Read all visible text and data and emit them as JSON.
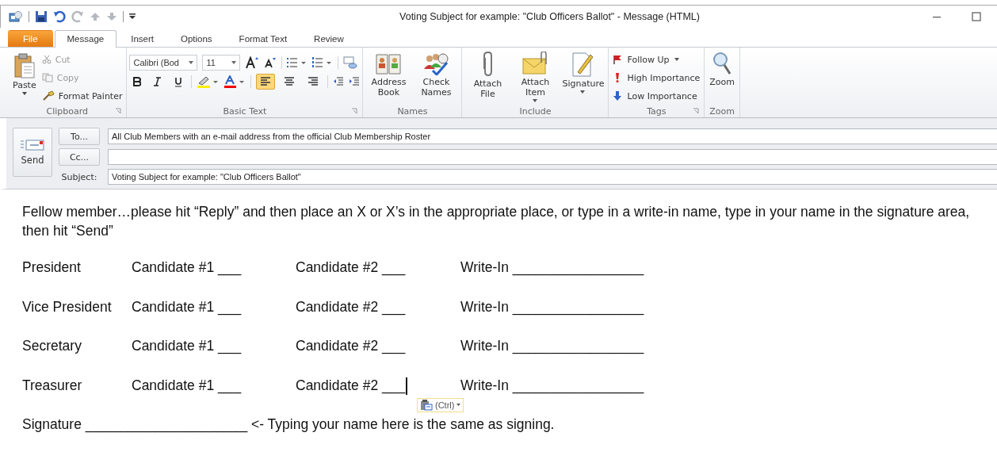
{
  "window": {
    "title": "Voting Subject for example: \"Club Officers Ballot\"  -  Message (HTML)"
  },
  "tabs": [
    {
      "label": "File",
      "kind": "file",
      "selected": false
    },
    {
      "label": "Message",
      "kind": "tab",
      "selected": true
    },
    {
      "label": "Insert",
      "kind": "tab",
      "selected": false
    },
    {
      "label": "Options",
      "kind": "tab",
      "selected": false
    },
    {
      "label": "Format Text",
      "kind": "tab",
      "selected": false
    },
    {
      "label": "Review",
      "kind": "tab",
      "selected": false
    }
  ],
  "ribbon": {
    "clipboard": {
      "label": "Clipboard",
      "paste": "Paste",
      "cut": "Cut",
      "copy": "Copy",
      "format_painter": "Format Painter"
    },
    "basic_text": {
      "label": "Basic Text",
      "font": "Calibri (Bod",
      "size": "11",
      "alignment": [
        {
          "selected": true
        },
        {
          "selected": false
        },
        {
          "selected": false
        }
      ]
    },
    "names": {
      "label": "Names",
      "buttons": [
        {
          "label": "Address Book",
          "kind": "address"
        },
        {
          "label": "Check Names",
          "kind": "check"
        }
      ]
    },
    "include": {
      "label": "Include",
      "buttons": [
        {
          "label": "Attach File",
          "kind": "clip",
          "dropdown": false
        },
        {
          "label": "Attach Item",
          "kind": "envelope",
          "dropdown": true
        },
        {
          "label": "Signature",
          "kind": "signature",
          "dropdown": true
        }
      ]
    },
    "tags": {
      "label": "Tags",
      "items": [
        {
          "label": "Follow Up",
          "kind": "flag",
          "dropdown": true
        },
        {
          "label": "High Importance",
          "kind": "high",
          "dropdown": false
        },
        {
          "label": "Low Importance",
          "kind": "low",
          "dropdown": false
        }
      ]
    },
    "zoom": {
      "label": "Zoom",
      "button": "Zoom"
    }
  },
  "header": {
    "send": "Send",
    "to": {
      "button": "To...",
      "value": "All Club Members with an e-mail address from the official Club Membership Roster"
    },
    "cc": {
      "button": "Cc..."
    },
    "subject": {
      "label": "Subject:",
      "value": "Voting Subject for example: \"Club Officers Ballot\""
    }
  },
  "body": {
    "intro": "Fellow member…please hit “Reply” and then place an X or X’s in the appropriate place, or type in a write-in name, type in your name in the signature area, then hit “Send”",
    "rows": [
      {
        "office": "President",
        "candidate_1": "Candidate #1 ___",
        "candidate_2": "Candidate #2 ___",
        "write_in": "Write-In _________________",
        "cursor": false
      },
      {
        "office": "Vice President",
        "candidate_1": "Candidate #1 ___",
        "candidate_2": "Candidate #2 ___",
        "write_in": "Write-In _________________",
        "cursor": false
      },
      {
        "office": "Secretary",
        "candidate_1": "Candidate #1 ___",
        "candidate_2": "Candidate #2 ___",
        "write_in": "Write-In _________________",
        "cursor": false
      },
      {
        "office": "Treasurer",
        "candidate_1": "Candidate #1 ___",
        "candidate_2": "Candidate #2 ___",
        "write_in": "Write-In _________________",
        "cursor": true
      }
    ],
    "paste_options": "(Ctrl)",
    "signature": "Signature _____________________ <- Typing your name here is the same as signing."
  }
}
